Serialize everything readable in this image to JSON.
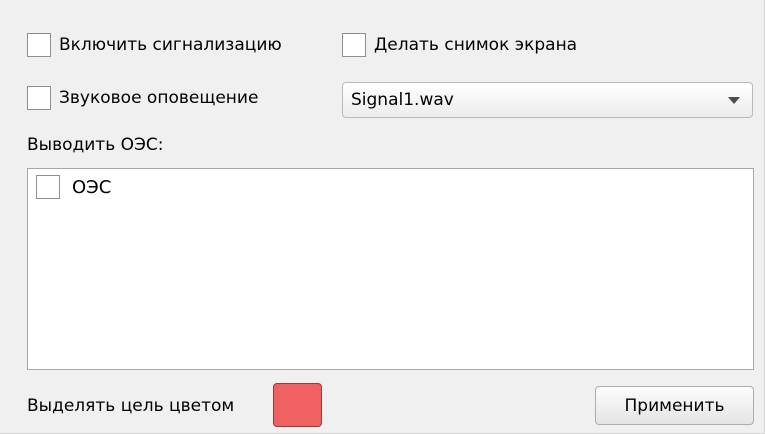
{
  "alarm": {
    "enable_label": "Включить сигнализацию",
    "screenshot_label": "Делать снимок экрана",
    "sound_label": "Звуковое оповещение",
    "sound_file": "Signal1.wav"
  },
  "oes": {
    "section_label": "Выводить ОЭС:",
    "items": [
      {
        "label": "ОЭС",
        "checked": false
      }
    ]
  },
  "highlight": {
    "label": "Выделять цель цветом",
    "color": "#f06262"
  },
  "apply_label": "Применить",
  "icons": {
    "dropdown": "chevron-down-icon"
  }
}
